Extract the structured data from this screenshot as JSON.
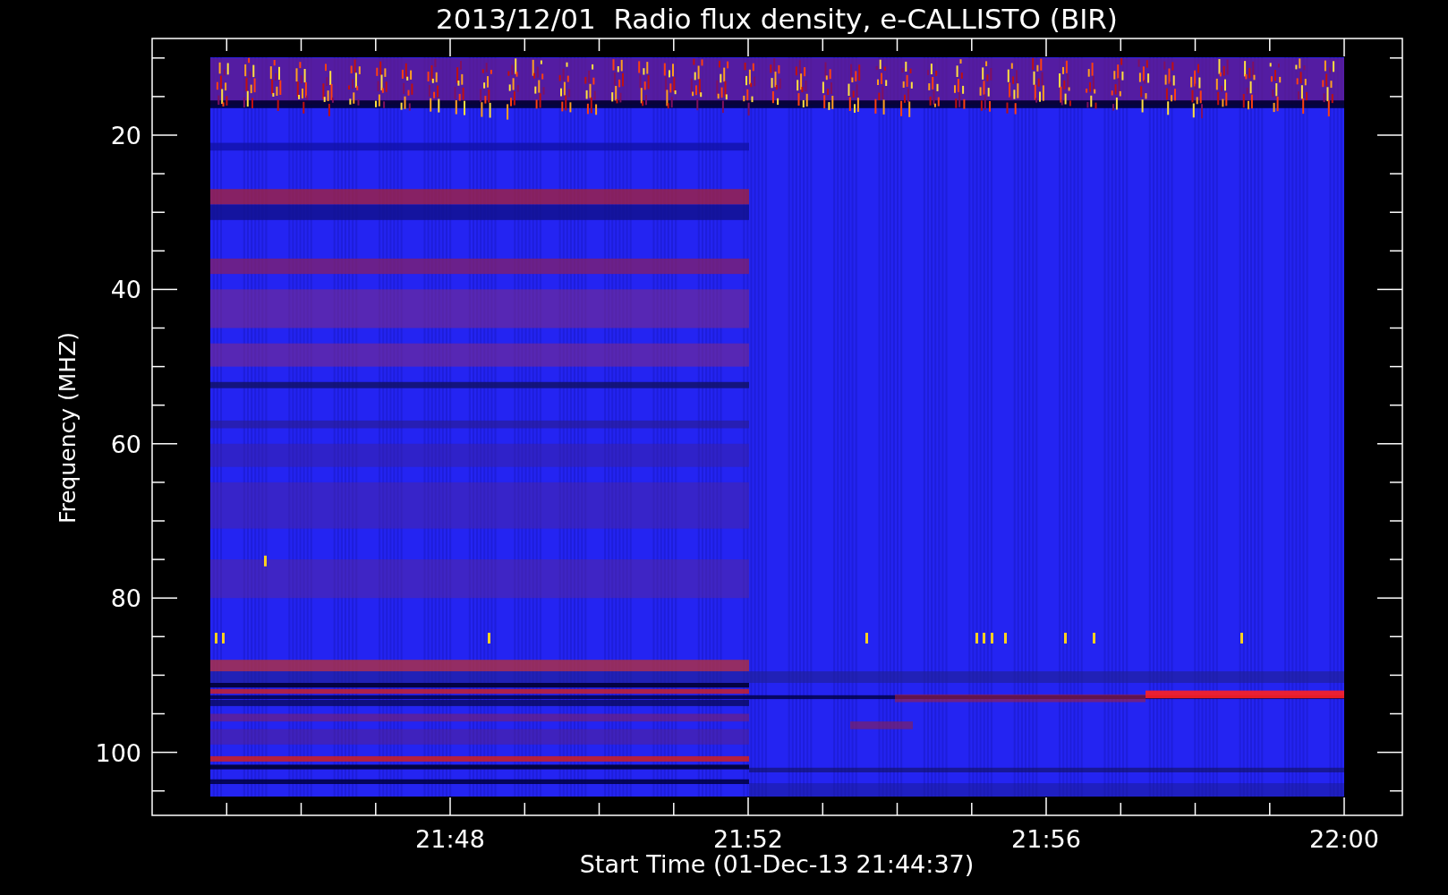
{
  "title": "2013/12/01  Radio flux density, e-CALLISTO (BIR)",
  "ylabel": "Frequency (MHZ)",
  "xlabel": "Start Time (01-Dec-13 21:44:37)",
  "yticks": [
    "20",
    "40",
    "60",
    "80",
    "100"
  ],
  "xticks": [
    "21:48",
    "21:52",
    "21:56",
    "22:00"
  ]
}
